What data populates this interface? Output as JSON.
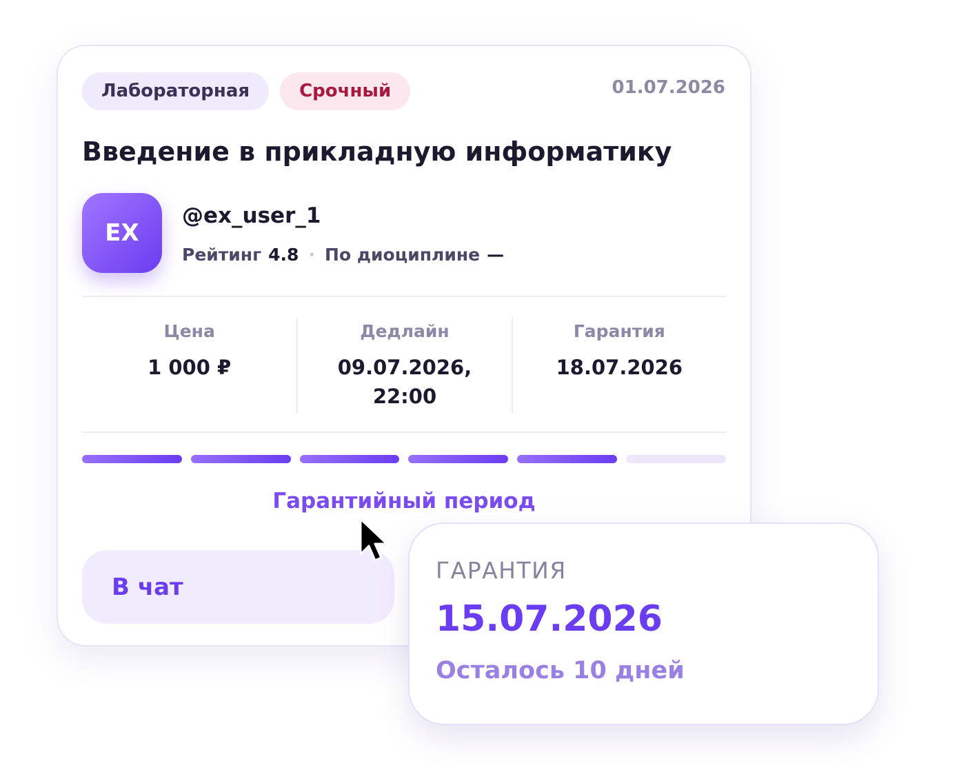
{
  "card": {
    "tags": [
      {
        "label": "Лабораторная"
      },
      {
        "label": "Срочный"
      }
    ],
    "date": "01.07.2026",
    "title": "Введение в прикладную информатику",
    "author": {
      "avatar_initials": "EX",
      "username": "@ex_user_1",
      "rating_label": "Рейтинг",
      "rating_value": "4.8",
      "separator": "•",
      "discipline_label": "По диоциплине",
      "discipline_value": "—"
    },
    "stats": [
      {
        "label": "Цена",
        "value": "1 000 ₽"
      },
      {
        "label": "Дедлайн",
        "value": "09.07.2026, 22:00"
      },
      {
        "label": "Гарантия",
        "value": "18.07.2026"
      }
    ],
    "progress": {
      "total_steps": 6,
      "completed_steps": 5
    },
    "progress_label": "Гарантийный период",
    "chat_button": "В чат"
  },
  "tooltip": {
    "heading": "ГАРАНТИЯ",
    "date": "15.07.2026",
    "remaining": "Осталось 10 дней"
  },
  "colors": {
    "accent": "#6b3df1",
    "tag_type_bg": "#efeafc",
    "tag_urgent_bg": "#fde7ee",
    "tag_urgent_text": "#a8173d",
    "progress_empty": "#ebe6f9"
  },
  "icons": {
    "pointer": "mouse-pointer-icon"
  }
}
